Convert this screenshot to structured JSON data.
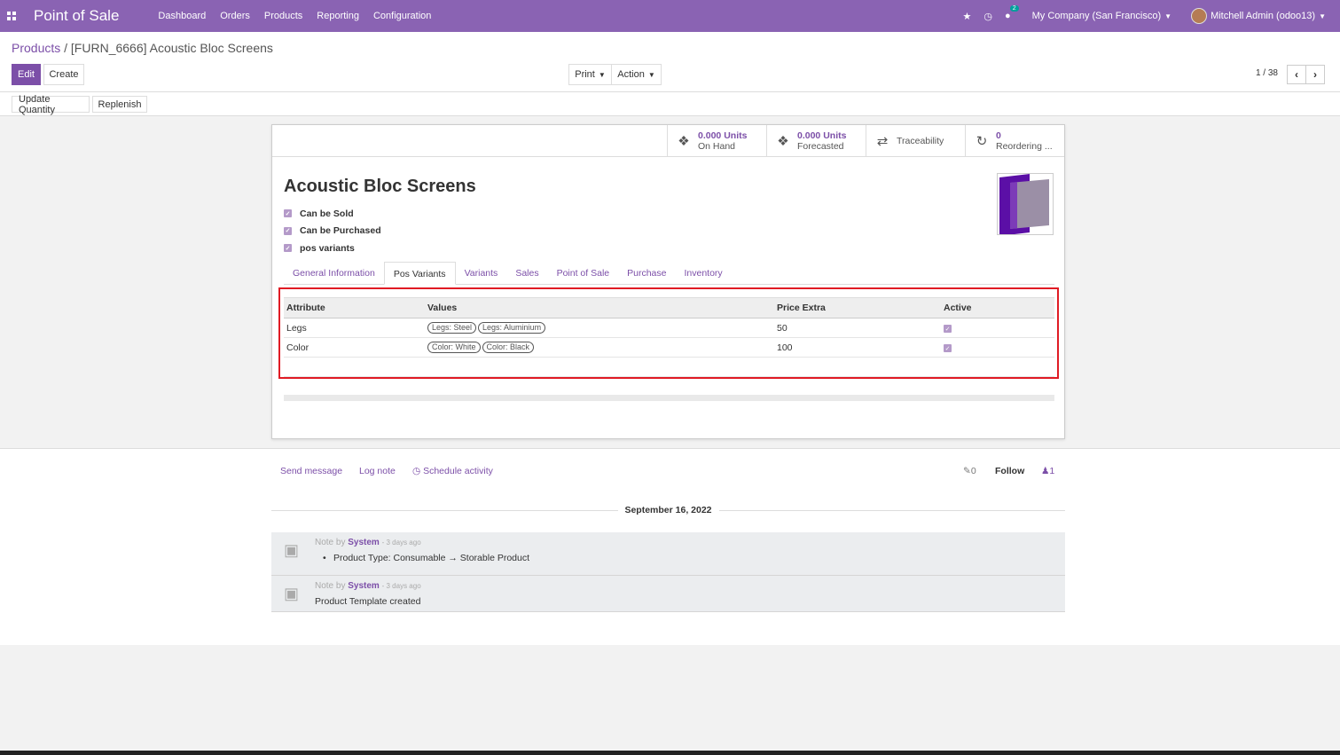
{
  "navbar": {
    "app_title": "Point of Sale",
    "menu": [
      "Dashboard",
      "Orders",
      "Products",
      "Reporting",
      "Configuration"
    ],
    "chat_count": "2",
    "company": "My Company (San Francisco)",
    "user": "Mitchell Admin (odoo13)"
  },
  "breadcrumb": {
    "parent": "Products",
    "separator": "/",
    "current": "[FURN_6666] Acoustic Bloc Screens"
  },
  "controls": {
    "edit": "Edit",
    "create": "Create",
    "print": "Print",
    "action": "Action",
    "pager": "1 / 38"
  },
  "status_actions": {
    "update_quantity": "Update Quantity",
    "replenish": "Replenish"
  },
  "smart_buttons": [
    {
      "value": "0.000 Units",
      "label": "On Hand",
      "icon": "cubes-icon"
    },
    {
      "value": "0.000 Units",
      "label": "Forecasted",
      "icon": "cubes-icon"
    },
    {
      "value": "",
      "label": "Traceability",
      "icon": "exchange-icon"
    },
    {
      "value": "0",
      "label": "Reordering ...",
      "icon": "refresh-icon"
    }
  ],
  "product": {
    "name": "Acoustic Bloc Screens",
    "checks": [
      "Can be Sold",
      "Can be Purchased",
      "pos variants"
    ]
  },
  "tabs": [
    "General Information",
    "Pos Variants",
    "Variants",
    "Sales",
    "Point of Sale",
    "Purchase",
    "Inventory"
  ],
  "active_tab": "Pos Variants",
  "variants_table": {
    "headers": [
      "Attribute",
      "Values",
      "Price Extra",
      "Active"
    ],
    "rows": [
      {
        "attribute": "Legs",
        "values": [
          "Legs: Steel",
          "Legs: Aluminium"
        ],
        "price_extra": "50",
        "active": true
      },
      {
        "attribute": "Color",
        "values": [
          "Color: White",
          "Color: Black"
        ],
        "price_extra": "100",
        "active": true
      }
    ]
  },
  "chatter": {
    "send_message": "Send message",
    "log_note": "Log note",
    "schedule_activity": "Schedule activity",
    "attachments": "0",
    "follow": "Follow",
    "followers": "1",
    "date": "September 16, 2022",
    "messages": [
      {
        "prefix": "Note by",
        "author": "System",
        "ago": "- 3 days ago",
        "body": "Product Type: Consumable → Storable Product",
        "bullet": true
      },
      {
        "prefix": "Note by",
        "author": "System",
        "ago": "- 3 days ago",
        "body": "Product Template created",
        "bullet": false
      }
    ]
  },
  "colors": {
    "brand": "#8a63b3",
    "accent": "#7c4fa8",
    "highlight": "#e01b24"
  }
}
